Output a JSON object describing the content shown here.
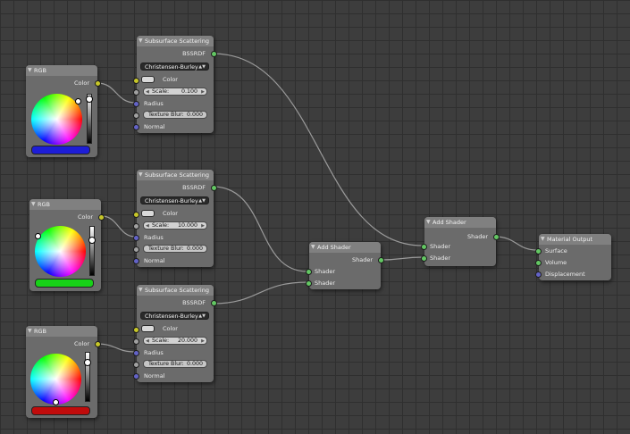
{
  "rgb_nodes": [
    {
      "title": "RGB",
      "output_label": "Color",
      "color_hex": "#1d1dd6",
      "brightness": 0.8
    },
    {
      "title": "RGB",
      "output_label": "Color",
      "color_hex": "#17d117",
      "brightness": 0.8
    },
    {
      "title": "RGB",
      "output_label": "Color",
      "color_hex": "#c00b0b",
      "brightness": 0.8
    }
  ],
  "sss_nodes": [
    {
      "title": "Subsurface Scattering",
      "output_label": "BSSRDF",
      "falloff": "Christensen-Burley",
      "color_label": "Color",
      "scale_label": "Scale:",
      "scale_value": "0.100",
      "radius_label": "Radius",
      "blur_label": "Texture Blur:",
      "blur_value": "0.000",
      "normal_label": "Normal"
    },
    {
      "title": "Subsurface Scattering",
      "output_label": "BSSRDF",
      "falloff": "Christensen-Burley",
      "color_label": "Color",
      "scale_label": "Scale:",
      "scale_value": "10.000",
      "radius_label": "Radius",
      "blur_label": "Texture Blur:",
      "blur_value": "0.000",
      "normal_label": "Normal"
    },
    {
      "title": "Subsurface Scattering",
      "output_label": "BSSRDF",
      "falloff": "Christensen-Burley",
      "color_label": "Color",
      "scale_label": "Scale:",
      "scale_value": "20.000",
      "radius_label": "Radius",
      "blur_label": "Texture Blur:",
      "blur_value": "0.000",
      "normal_label": "Normal"
    }
  ],
  "add_shader_nodes": [
    {
      "title": "Add Shader",
      "output_label": "Shader",
      "input1_label": "Shader",
      "input2_label": "Shader"
    },
    {
      "title": "Add Shader",
      "output_label": "Shader",
      "input1_label": "Shader",
      "input2_label": "Shader"
    }
  ],
  "material_output": {
    "title": "Material Output",
    "surface_label": "Surface",
    "volume_label": "Volume",
    "displacement_label": "Displacement"
  },
  "colors": {
    "link": "#9a9a9a",
    "socket_color": "#c7c729",
    "socket_shader": "#63c763",
    "socket_vector": "#6363c7",
    "socket_value": "#a1a1a1"
  }
}
